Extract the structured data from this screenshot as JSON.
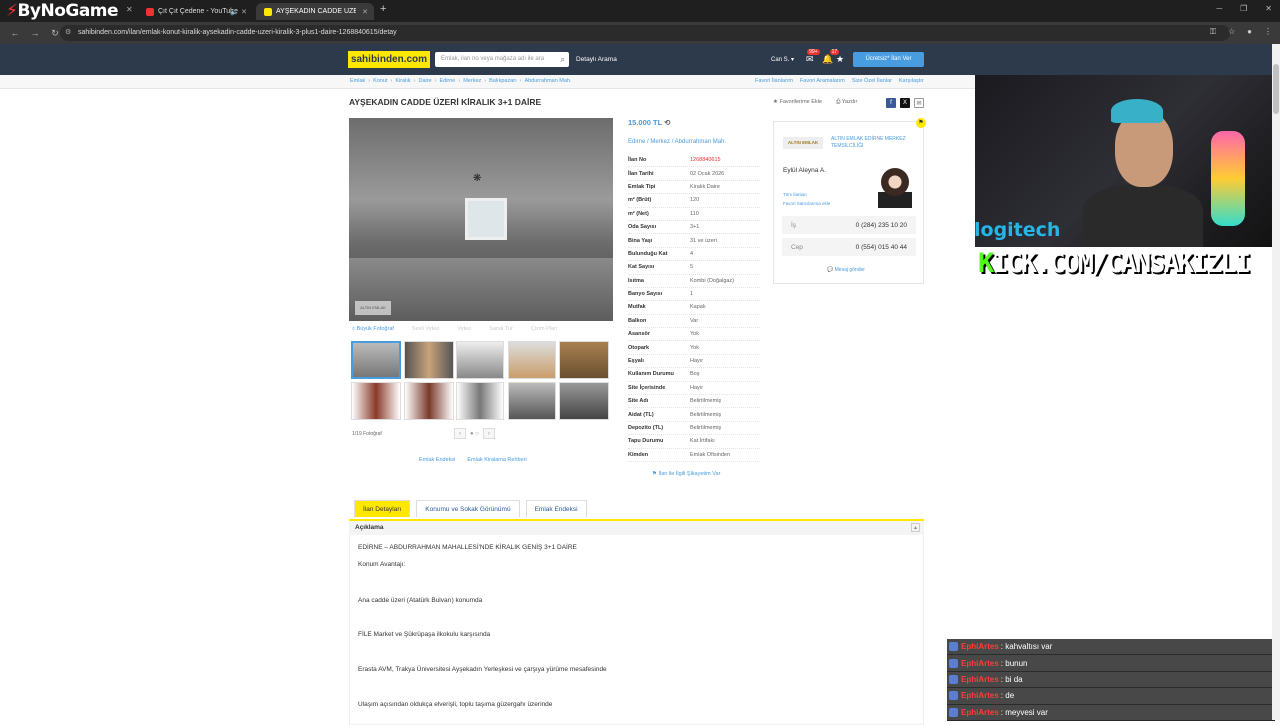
{
  "browser": {
    "tabs": [
      {
        "label": "Çıt Çıt Çedene - YouTube",
        "icon": "youtube-icon"
      },
      {
        "label": "AYŞEKADIN CADDE ÜZERİ KİRALIK",
        "icon": "sahibinden-icon"
      }
    ],
    "url": "sahibinden.com/ilan/emlak-konut-kiralik-aysekadin-cadde-uzeri-kiralik-3-plus1-daire-1268840615/detay",
    "new_tab": "+"
  },
  "brand": {
    "logo": "ByNoGame"
  },
  "site": {
    "logo": "sahibinden.com",
    "search_placeholder": "Emlak, ilan no veya mağaza adı ile ara",
    "detailed_search": "Detaylı Arama",
    "user": "Can S. ▾",
    "badges": [
      "99+",
      "17"
    ],
    "post_button": "Ücretsiz* İlan Ver"
  },
  "breadcrumb": [
    "Emlak",
    "Konut",
    "Kiralık",
    "Daire",
    "Edirne",
    "Merkez",
    "Balıkpazarı",
    "Abdurrahman Mah."
  ],
  "crumb_links": [
    "Favori İlanlarım",
    "Favori Aramalarım",
    "Size Özel İlanlar",
    "Karşılaştır"
  ],
  "listing": {
    "title": "AYŞEKADIN CADDE ÜZERİ KİRALIK 3+1 DAİRE",
    "actions": [
      "Favorilerime Ekle",
      "Yazdır"
    ],
    "price": "15.000 TL",
    "location": "Edirne  /  Merkez  /  Abdurrahman Mah.",
    "photo_tools": [
      "Büyük Fotoğraf",
      "Sesli Video",
      "Video",
      "Sanal Tur",
      "Çizim Plan"
    ],
    "photo_count": "1/19 Fotoğraf",
    "under_links": [
      "Emlak Endeksi",
      "Emlak Kiralama Rehberi"
    ],
    "complain": "İlan ile İlgili Şikayetim Var",
    "info": [
      {
        "k": "İlan No",
        "v": "1268840615"
      },
      {
        "k": "İlan Tarihi",
        "v": "02 Ocak 2026"
      },
      {
        "k": "Emlak Tipi",
        "v": "Kiralık Daire"
      },
      {
        "k": "m² (Brüt)",
        "v": "120"
      },
      {
        "k": "m² (Net)",
        "v": "110"
      },
      {
        "k": "Oda Sayısı",
        "v": "3+1"
      },
      {
        "k": "Bina Yaşı",
        "v": "31 ve üzeri"
      },
      {
        "k": "Bulunduğu Kat",
        "v": "4"
      },
      {
        "k": "Kat Sayısı",
        "v": "5"
      },
      {
        "k": "Isıtma",
        "v": "Kombi (Doğalgaz)"
      },
      {
        "k": "Banyo Sayısı",
        "v": "1"
      },
      {
        "k": "Mutfak",
        "v": "Kapalı"
      },
      {
        "k": "Balkon",
        "v": "Var"
      },
      {
        "k": "Asansör",
        "v": "Yok"
      },
      {
        "k": "Otopark",
        "v": "Yok"
      },
      {
        "k": "Eşyalı",
        "v": "Hayır"
      },
      {
        "k": "Kullanım Durumu",
        "v": "Boş"
      },
      {
        "k": "Site İçerisinde",
        "v": "Hayır"
      },
      {
        "k": "Site Adı",
        "v": "Belirtilmemiş"
      },
      {
        "k": "Aidat (TL)",
        "v": "Belirtilmemiş"
      },
      {
        "k": "Depozito (TL)",
        "v": "Belirtilmemiş"
      },
      {
        "k": "Tapu Durumu",
        "v": "Kat İrtifakı"
      },
      {
        "k": "Kimden",
        "v": "Emlak Ofisinden"
      }
    ]
  },
  "seller": {
    "logo_text": "ALTIN EMLAK",
    "firm": "ALTIN EMLAK EDİRNE MERKEZ TEMSİLCİLİĞİ",
    "name": "Eylül Aleyna A.",
    "link1": "Tüm İlanları",
    "link2": "Favori Satıcılarıma ekle",
    "phones": [
      {
        "label": "İş",
        "value": "0 (284) 235 10 20"
      },
      {
        "label": "Cep",
        "value": "0 (554) 015 40 44"
      }
    ],
    "message": "Mesaj gönder"
  },
  "tabs": [
    "İlan Detayları",
    "Konumu ve Sokak Görünümü",
    "Emlak Endeksi"
  ],
  "description": {
    "heading": "Açıklama",
    "lines": [
      "EDİRNE – ABDURRAHMAN MAHALLESİ'NDE KİRALIK GENİŞ 3+1 DAİRE",
      "Konum Avantajı:",
      "Ana cadde üzeri (Atatürk Bulvarı) konumda",
      "FİLE Market ve Şükrüpaşa ilkokulu karşısında",
      "Erasta AVM, Trakya Üniversitesi Ayşekadın Yerleşkesi ve çarşıya yürüme mesafesinde",
      "Ulaşım açısından oldukça elverişli, toplu taşıma güzergahı üzerinde"
    ]
  },
  "overlay": {
    "logitech": "logitech",
    "kick_url_k": "K",
    "kick_url_rest": "ICK.COM/CANSAKIZLI",
    "chat": [
      {
        "user": "EphiArtes",
        "msg": ": kahvaltısı var"
      },
      {
        "user": "EphiArtes",
        "msg": ": bunun"
      },
      {
        "user": "EphiArtes",
        "msg": ": bi da"
      },
      {
        "user": "EphiArtes",
        "msg": ": de"
      },
      {
        "user": "EphiArtes",
        "msg": ": meyvesi var"
      }
    ]
  },
  "colors": {
    "accent": "#ffe800",
    "link": "#489ce0",
    "header": "#2d3a4b",
    "kick": "#53fc18"
  }
}
